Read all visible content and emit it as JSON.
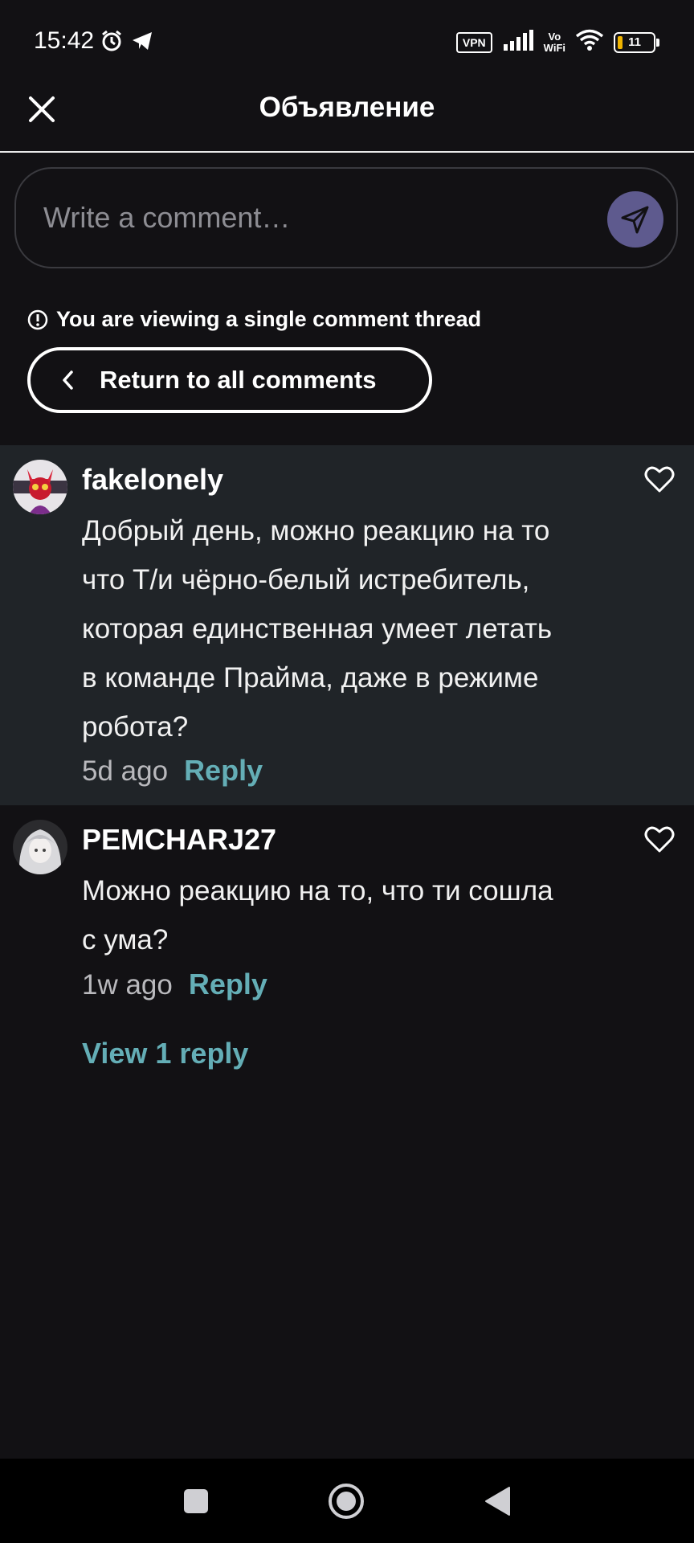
{
  "status_bar": {
    "time": "15:42",
    "vpn": "VPN",
    "vowifi_top": "Vo",
    "vowifi_bottom": "WiFi",
    "battery": "11"
  },
  "header": {
    "title": "Объявление"
  },
  "composer": {
    "placeholder": "Write a comment…",
    "value": ""
  },
  "thread": {
    "notice": "You are viewing a single comment thread",
    "return_label": "Return to all comments"
  },
  "comments": [
    {
      "username": "fakelonely",
      "text_lines": [
        "Добрый день, можно реакцию на то",
        "что Т/и чёрно-белый истребитель,",
        "которая единственная умеет летать",
        "в команде Прайма, даже в режиме",
        "робота?"
      ],
      "time": "5d ago",
      "reply": "Reply"
    },
    {
      "username": "PEMCHARJ27",
      "text_lines": [
        "Можно реакцию на то, что ти сошла",
        "с ума?"
      ],
      "time": "1w ago",
      "reply": "Reply",
      "view_replies": "View 1 reply"
    }
  ],
  "colors": {
    "background": "#121114",
    "highlight": "#202428",
    "accent": "#64aeb6",
    "send_button": "#5e5a8e"
  },
  "icons": [
    "alarm-icon",
    "telegram-icon",
    "signal-icon",
    "wifi-icon",
    "close-icon",
    "send-icon",
    "info-icon",
    "chevron-left-icon",
    "heart-icon",
    "home-icon",
    "back-icon",
    "recents-icon"
  ]
}
